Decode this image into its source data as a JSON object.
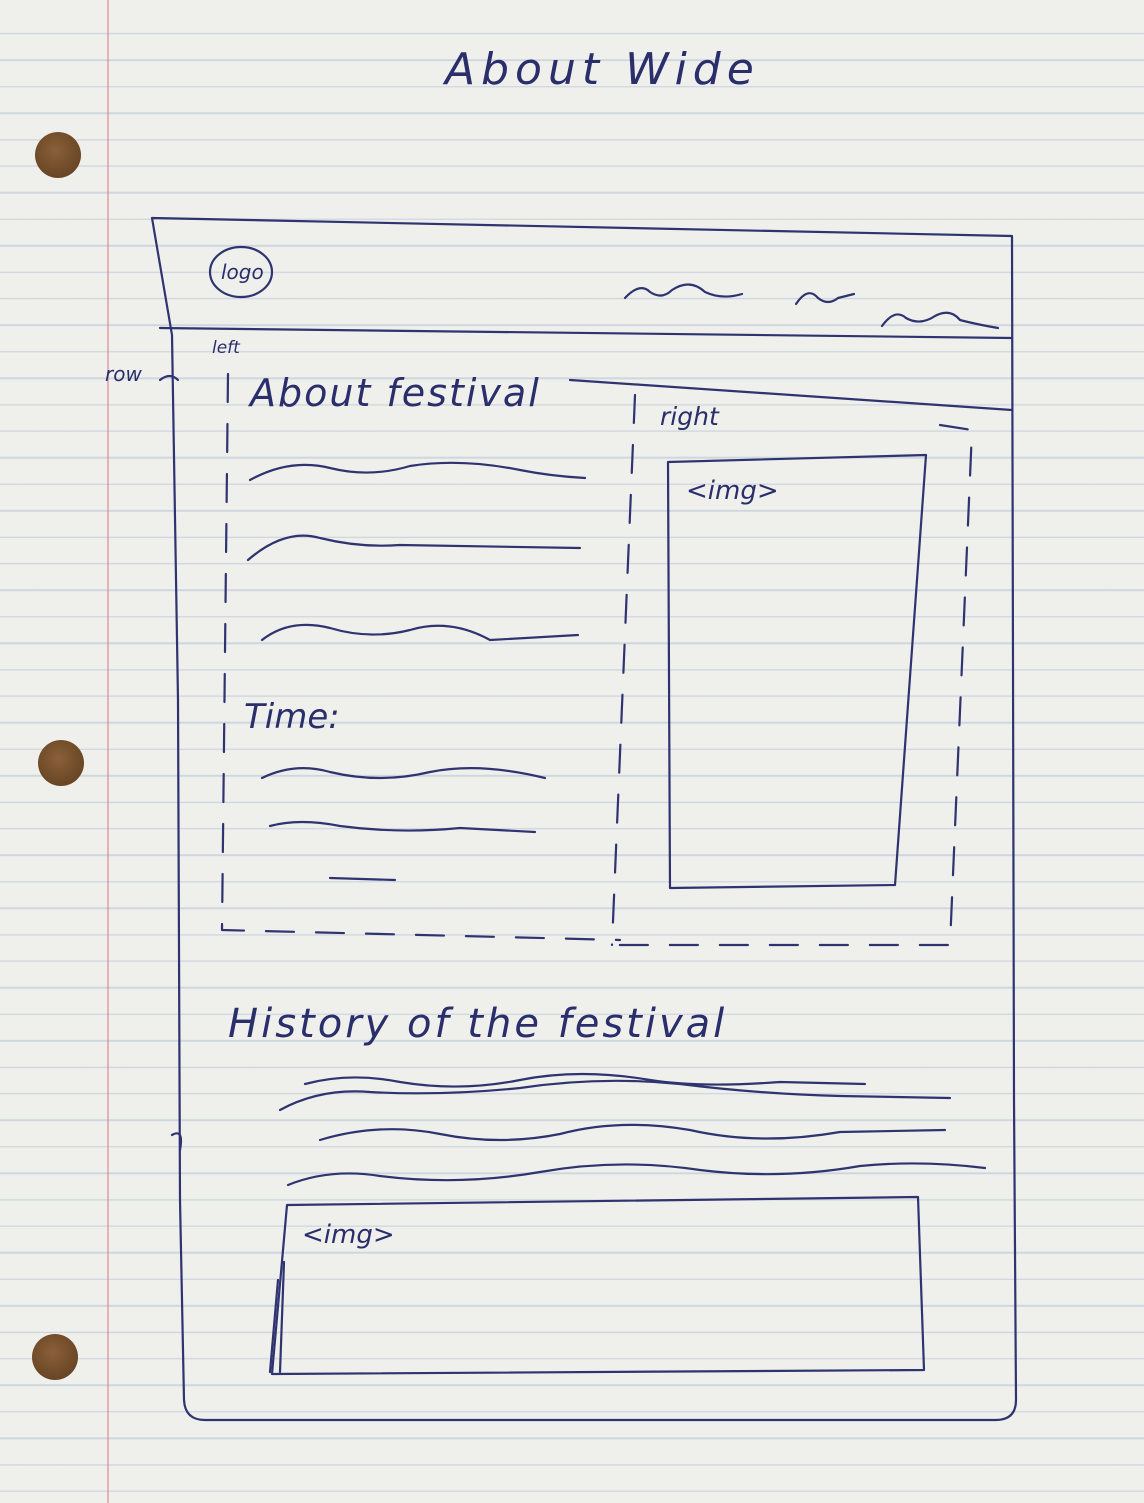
{
  "page_title": "About Wide",
  "header": {
    "logo": "logo"
  },
  "annotations": {
    "row": "row",
    "left": "left",
    "right": "right"
  },
  "left_column": {
    "heading": "About festival",
    "time_label": "Time:"
  },
  "right_column": {
    "image_label": "<img>"
  },
  "history": {
    "heading": "History of the festival",
    "image_label": "<img>"
  },
  "colors": {
    "ink": "#2f3370",
    "paper": "#efefec",
    "rule_line": "#7896be",
    "margin_line": "#d7828c"
  }
}
